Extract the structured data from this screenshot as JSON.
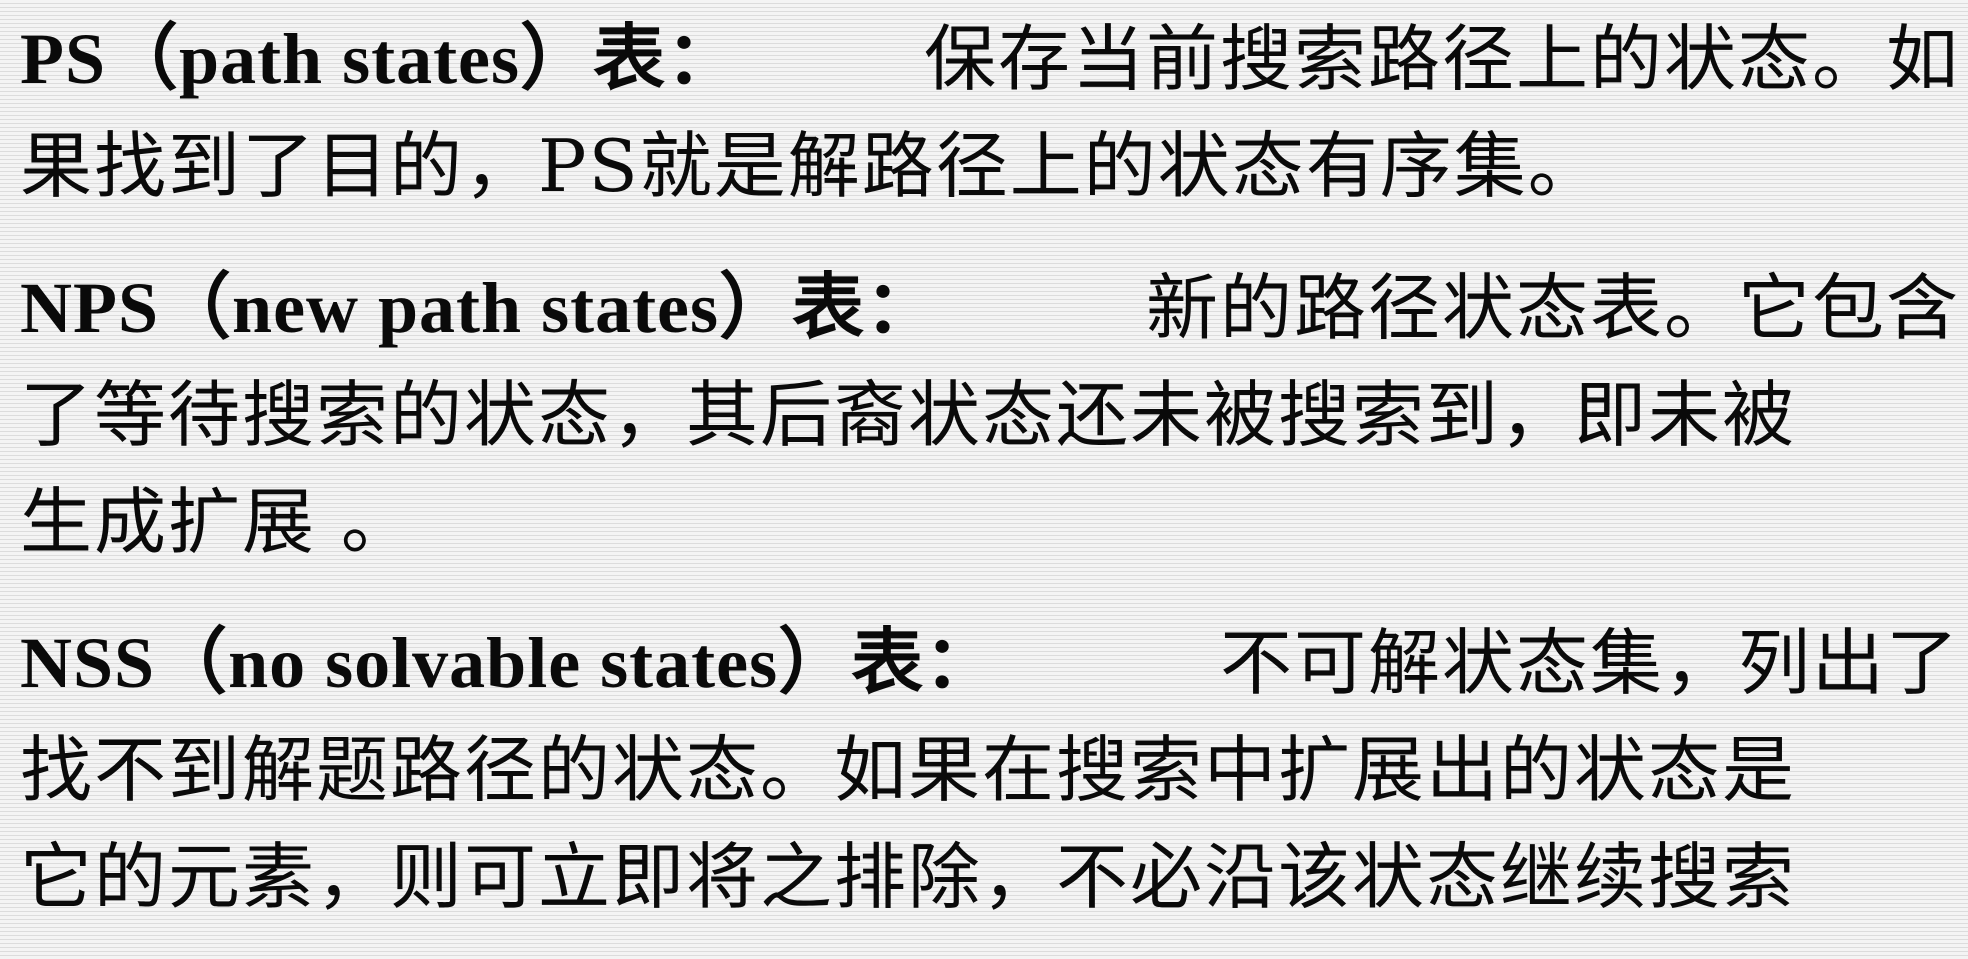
{
  "paragraphs": [
    {
      "term": "PS（path  states）表：",
      "line1_rest": "保存当前搜索路径上的状态。如",
      "line2": "果找到了目的，PS就是解路径上的状态有序集。"
    },
    {
      "term": "NPS（new  path  states）表：",
      "line1_rest": "新的路径状态表。它包含",
      "line2": "了等待搜索的状态，其后裔状态还未被搜索到，即未被",
      "line3": "生成扩展 。"
    },
    {
      "term": "NSS（no  solvable  states）表：",
      "line1_rest": "不可解状态集，列出了",
      "line2": "找不到解题路径的状态。如果在搜索中扩展出的状态是",
      "line3": "它的元素，则可立即将之排除，不必沿该状态继续搜索"
    }
  ]
}
